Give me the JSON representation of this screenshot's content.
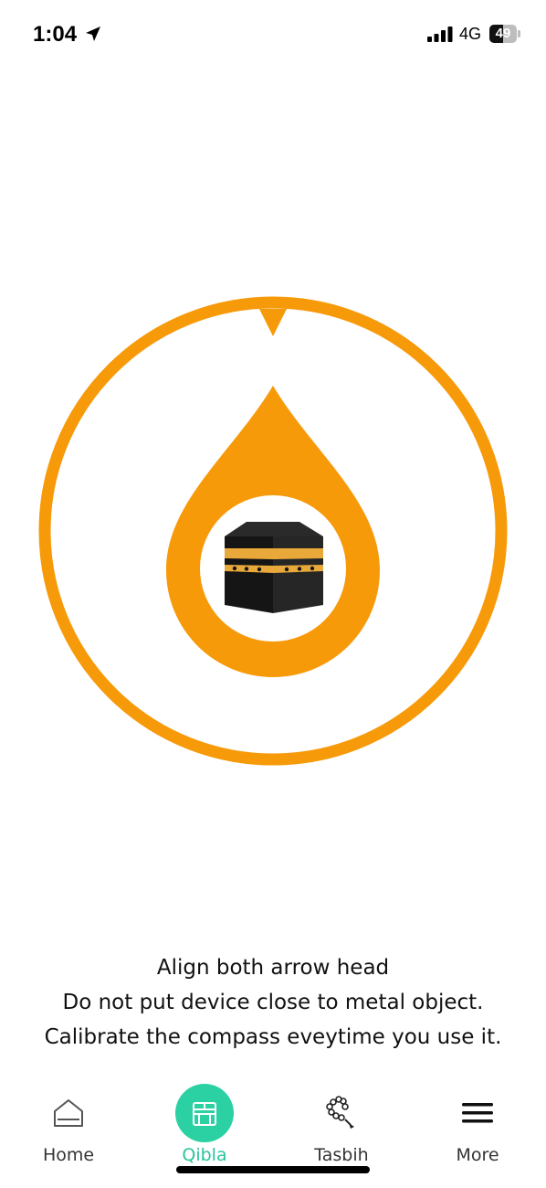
{
  "status_bar": {
    "time": "1:04",
    "network": "4G",
    "battery": "49",
    "battery_level": 0.49,
    "icons": [
      "location-arrow-icon",
      "signal-bars-icon",
      "battery-icon"
    ]
  },
  "compass": {
    "icons": [
      "compass-ring",
      "qibla-pointer",
      "kaaba-icon"
    ],
    "colors": {
      "accent": "#F79A0A",
      "kaaba": "#1c1c1c",
      "kaaba_band": "#E8A93A"
    }
  },
  "instructions": {
    "line1": "Align both arrow head",
    "line2": "Do not put device close to metal object.",
    "line3": "Calibrate the compass eveytime you use it."
  },
  "tabs": [
    {
      "label": "Home",
      "icon": "home-icon",
      "active": false
    },
    {
      "label": "Qibla",
      "icon": "kaaba-tab-icon",
      "active": true
    },
    {
      "label": "Tasbih",
      "icon": "tasbih-beads-icon",
      "active": false
    },
    {
      "label": "More",
      "icon": "menu-icon",
      "active": false
    }
  ],
  "colors": {
    "accent": "#F79A0A",
    "tab_active": "#2BC49B",
    "tab_active_bg": "#2BD1A3",
    "background": "#FFFFFF",
    "text": "#111111"
  }
}
